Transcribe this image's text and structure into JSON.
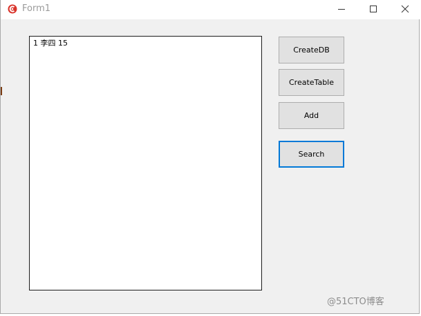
{
  "window": {
    "title": "Form1",
    "controls": {
      "minimize_icon": "minimize-icon",
      "maximize_icon": "maximize-icon",
      "close_icon": "close-icon"
    }
  },
  "listbox": {
    "items": [
      {
        "text": "1 李四 15"
      }
    ]
  },
  "buttons": {
    "create_db": "CreateDB",
    "create_table": "CreateTable",
    "add": "Add",
    "search": "Search"
  },
  "watermark": "@51CTO博客",
  "colors": {
    "focus_border": "#0078d7",
    "button_face": "#e1e1e1",
    "form_background": "#f0f0f0",
    "app_icon_red": "#d9342b"
  }
}
